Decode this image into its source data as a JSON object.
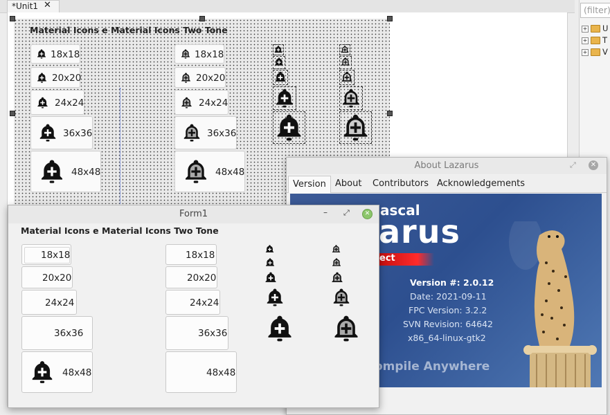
{
  "editor": {
    "tab_label": "*Unit1",
    "tab_close": "✕",
    "designer_title": "Material Icons e Material Icons Two Tone",
    "buttons_col1": [
      "18x18",
      "20x20",
      "24x24",
      "36x36",
      "48x48"
    ],
    "buttons_col2": [
      "18x18",
      "20x20",
      "24x24",
      "36x36",
      "48x48"
    ]
  },
  "object_tree": {
    "filter_placeholder": "(filter)",
    "items": [
      "U",
      "T",
      "V"
    ]
  },
  "about": {
    "title": "About Lazarus",
    "tabs": [
      "Version",
      "About",
      "Contributors",
      "Acknowledgements"
    ],
    "selected_tab": "Version",
    "splash_word_top": "ascal",
    "splash_word_big": "arus",
    "splash_ribbon": "ect",
    "version": "Version #: 2.0.12",
    "date": "Date: 2021-09-11",
    "fpc": "FPC Version: 3.2.2",
    "svn": "SVN Revision: 64642",
    "platform": "x86_64-linux-gtk2",
    "tagline": "ompile Anywhere"
  },
  "form1": {
    "title": "Form1",
    "heading": "Material Icons e Material Icons Two Tone",
    "buttons_col1": [
      "18x18",
      "20x20",
      "24x24",
      "36x36",
      "48x48"
    ],
    "buttons_col2": [
      "18x18",
      "20x20",
      "24x24",
      "36x36",
      "48x48"
    ]
  },
  "colors": {
    "splash_blue": "#2d4f8f",
    "ribbon_red": "#d61a1a",
    "close_green": "#8cc66b"
  },
  "icons": {
    "bell": "bell-plus-icon",
    "bell_two_tone": "bell-plus-two-tone-icon"
  }
}
